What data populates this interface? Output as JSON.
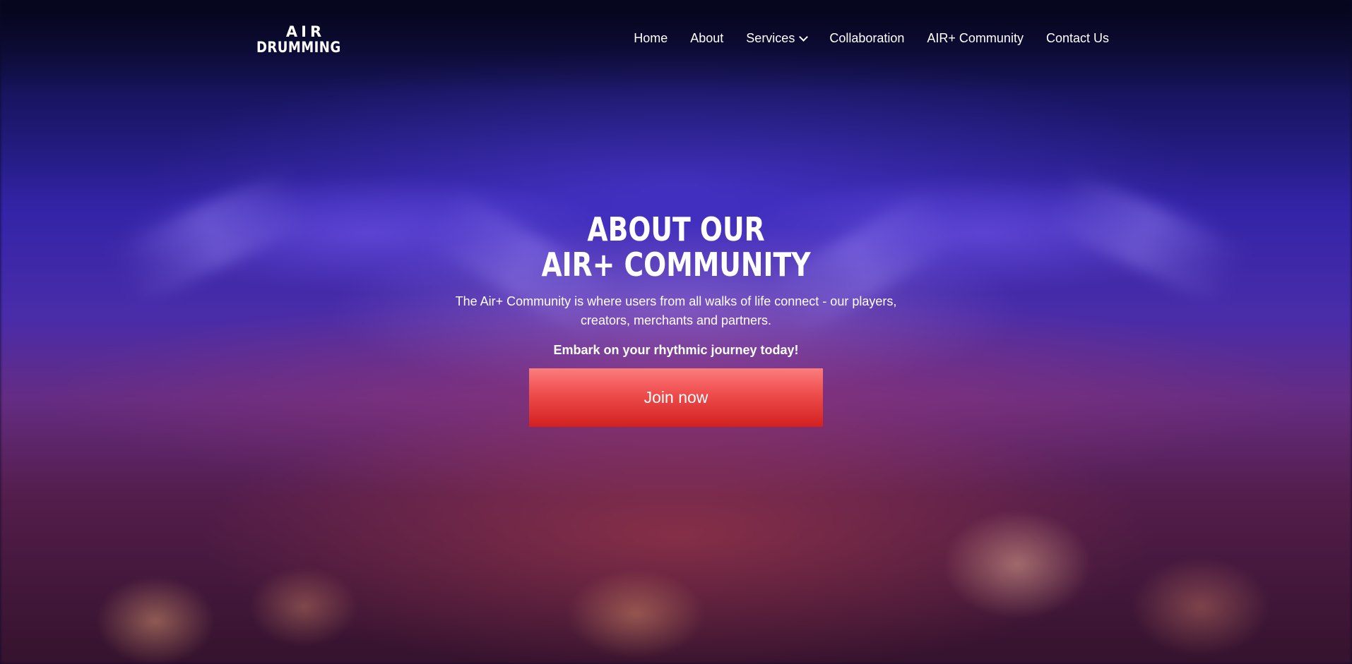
{
  "logo": {
    "line1": "AIR",
    "line2": "DRUMMING"
  },
  "nav": {
    "items": [
      {
        "label": "Home"
      },
      {
        "label": "About"
      },
      {
        "label": "Services",
        "has_dropdown": true
      },
      {
        "label": "Collaboration"
      },
      {
        "label": "AIR+ Community"
      },
      {
        "label": "Contact Us"
      }
    ]
  },
  "hero": {
    "title_line1": "ABOUT OUR",
    "title_line2": "AIR+ COMMUNITY",
    "description": "The Air+ Community is where users from all walks of life connect - our players, creators, merchants and partners.",
    "cta_text": "Embark on your rhythmic journey today!",
    "join_button": "Join now"
  },
  "colors": {
    "button_top": "#fb7d7d",
    "button_bottom": "#d22020",
    "text": "#ffffff"
  }
}
